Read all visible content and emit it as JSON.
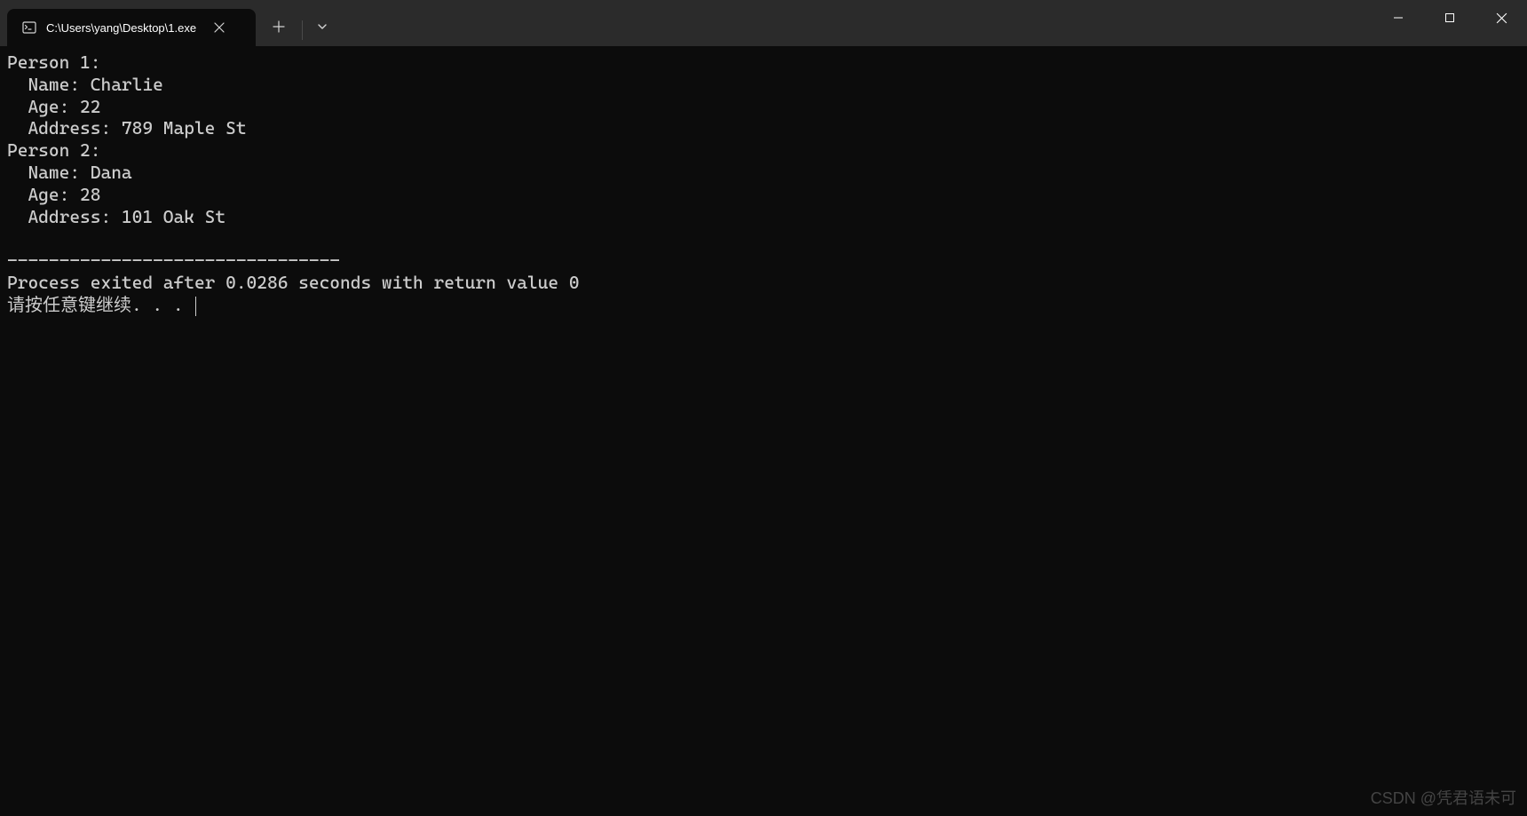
{
  "window": {
    "tab_title": "C:\\Users\\yang\\Desktop\\1.exe"
  },
  "output": {
    "persons": [
      {
        "header": "Person 1:",
        "name_label": "  Name: ",
        "name": "Charlie",
        "age_label": "  Age: ",
        "age": "22",
        "address_label": "  Address: ",
        "address": "789 Maple St"
      },
      {
        "header": "Person 2:",
        "name_label": "  Name: ",
        "name": "Dana",
        "age_label": "  Age: ",
        "age": "28",
        "address_label": "  Address: ",
        "address": "101 Oak St"
      }
    ],
    "separator": "--------------------------------",
    "exit_message": "Process exited after 0.0286 seconds with return value 0",
    "prompt": "请按任意键继续. . . "
  },
  "watermark": "CSDN @凭君语未可"
}
